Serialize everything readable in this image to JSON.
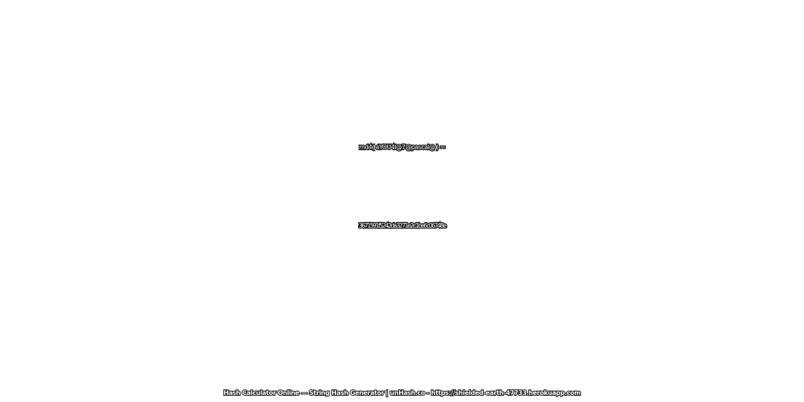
{
  "expression": "md4( aYOU4l@7@pascal@ ) =",
  "hash": "3671591f5242da3271e2c1be6c06748e",
  "footer": "Hash Calculator Online — String Hash Generator | unHash.co - https://shielded-earth-47733.herokuapp.com",
  "colors": {
    "background": "#ffffff",
    "text_fill": "#ffffff",
    "text_outline": "#111111"
  }
}
